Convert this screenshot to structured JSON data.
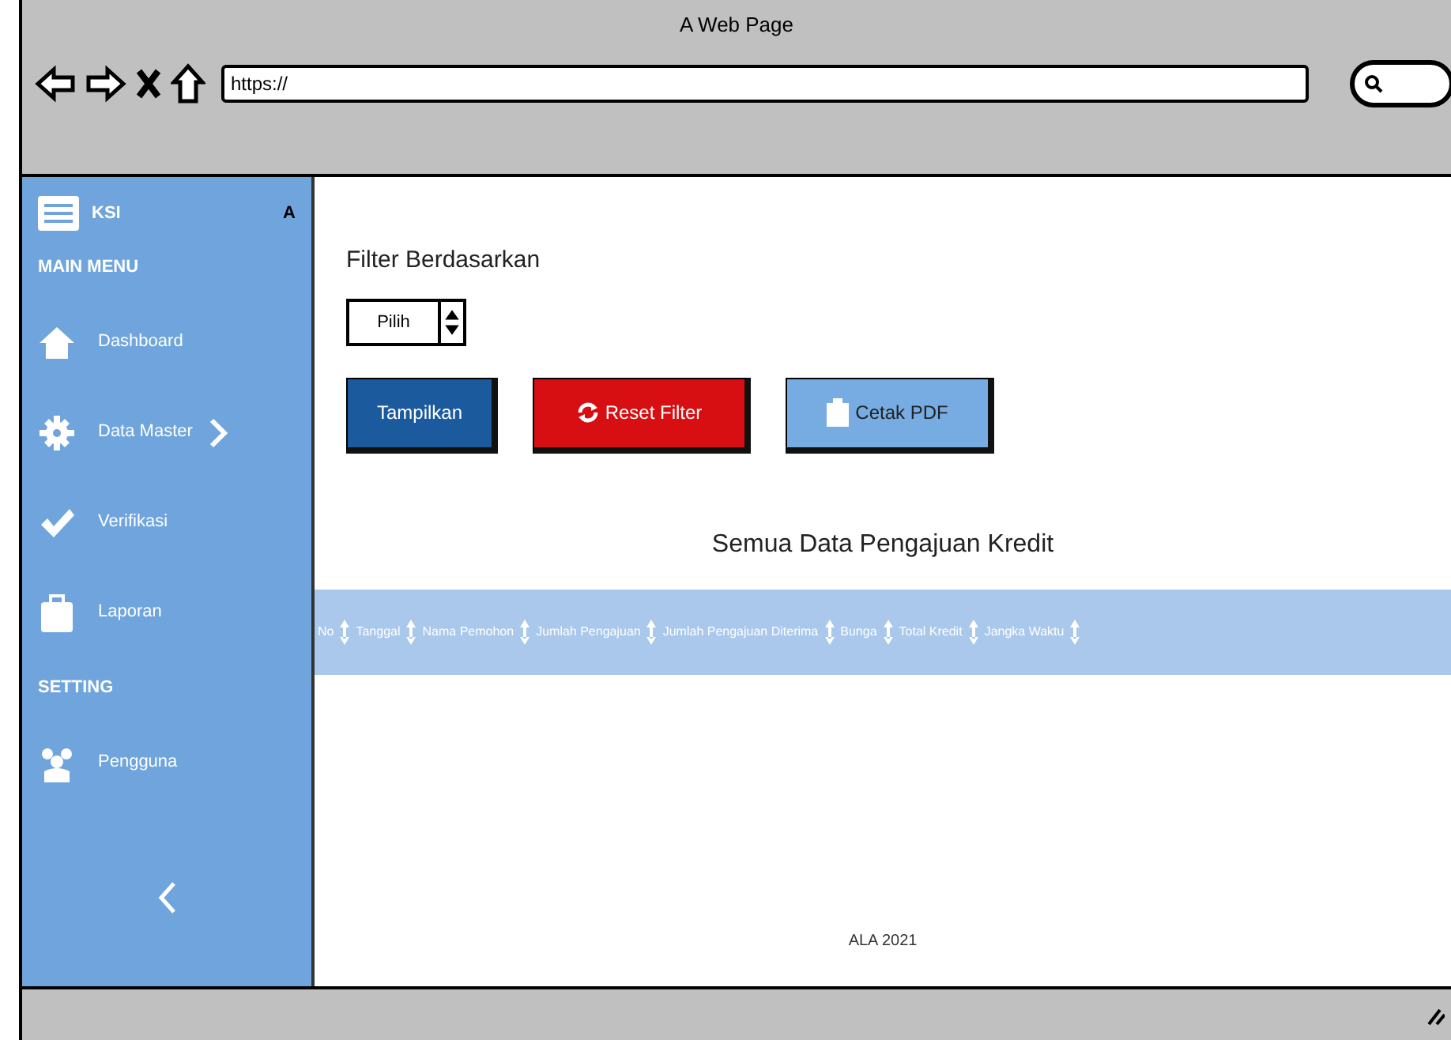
{
  "window": {
    "title": "A Web Page"
  },
  "address_bar": {
    "value": "https://"
  },
  "sidebar": {
    "brand": "KSI",
    "brand_suffix": "A",
    "items": [
      {
        "kind": "heading",
        "label": "MAIN MENU"
      },
      {
        "kind": "item",
        "label": "Dashboard",
        "has_submenu": false
      },
      {
        "kind": "item",
        "label": "Data Master",
        "has_submenu": true
      },
      {
        "kind": "item",
        "label": "Verifikasi",
        "has_submenu": false
      },
      {
        "kind": "item",
        "label": "Laporan",
        "has_submenu": false
      },
      {
        "kind": "heading",
        "label": "SETTING"
      },
      {
        "kind": "item",
        "label": "Pengguna",
        "has_submenu": false
      }
    ]
  },
  "filter": {
    "label": "Filter Berdasarkan",
    "select": "Pilih"
  },
  "buttons": [
    {
      "kind": "primary",
      "label": "Tampilkan"
    },
    {
      "kind": "danger",
      "label": "Reset Filter"
    },
    {
      "kind": "print",
      "label": "Cetak PDF"
    }
  ],
  "table": {
    "title": "Semua Data Pengajuan Kredit",
    "columns": [
      "No",
      "Tanggal",
      "Nama Pemohon",
      "Jumlah Pengajuan",
      "Jumlah Pengajuan Diterima",
      "Bunga",
      "Total Kredit",
      "Jangka Waktu"
    ]
  },
  "footer": "ALA 2021"
}
